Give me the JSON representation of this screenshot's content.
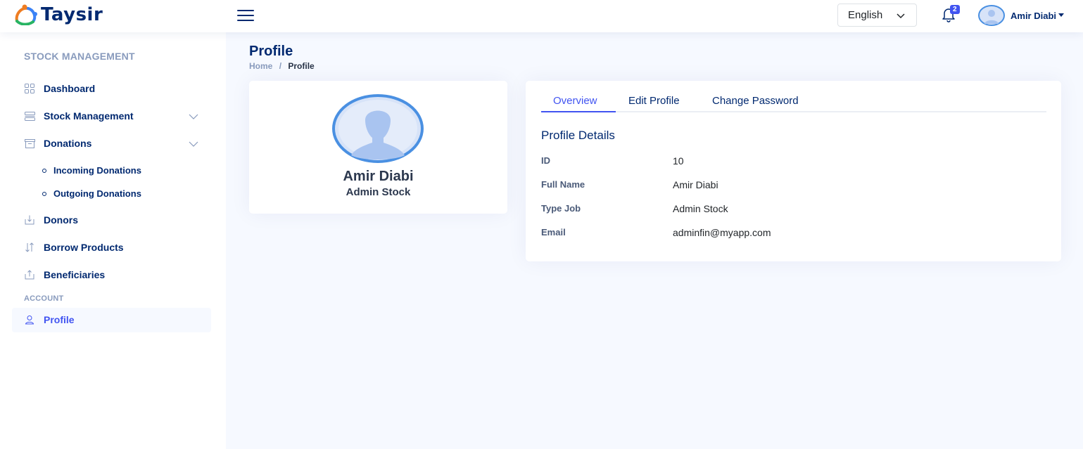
{
  "header": {
    "logo_text": "Taysir",
    "language": "English",
    "notification_count": "2",
    "user_name": "Amir Diabi"
  },
  "sidebar": {
    "heading": "STOCK MANAGEMENT",
    "items": [
      {
        "label": "Dashboard",
        "icon": "grid-icon"
      },
      {
        "label": "Stock Management",
        "icon": "menu-icon"
      },
      {
        "label": "Donations",
        "icon": "archive-icon"
      },
      {
        "label": "Donors",
        "icon": "box-arrow-in-icon"
      },
      {
        "label": "Borrow Products",
        "icon": "arrows-updown-icon"
      },
      {
        "label": "Beneficiaries",
        "icon": "box-arrow-up-icon"
      }
    ],
    "donations_sub": [
      "Incoming Donations",
      "Outgoing Donations"
    ],
    "account_heading": "ACCOUNT",
    "profile_label": "Profile"
  },
  "page": {
    "title": "Profile",
    "breadcrumb_home": "Home",
    "breadcrumb_separator": "/",
    "breadcrumb_current": "Profile"
  },
  "profile_card": {
    "name": "Amir Diabi",
    "role": "Admin Stock"
  },
  "tabs": [
    "Overview",
    "Edit Profile",
    "Change Password"
  ],
  "details": {
    "title": "Profile Details",
    "rows": [
      {
        "label": "ID",
        "value": "10"
      },
      {
        "label": "Full Name",
        "value": "Amir Diabi"
      },
      {
        "label": "Type Job",
        "value": "Admin Stock"
      },
      {
        "label": "Email",
        "value": "adminfin@myapp.com"
      }
    ]
  },
  "colors": {
    "primary": "#4154f1",
    "navy": "#012970",
    "muted": "#899bbd",
    "background": "#f6f9ff"
  }
}
